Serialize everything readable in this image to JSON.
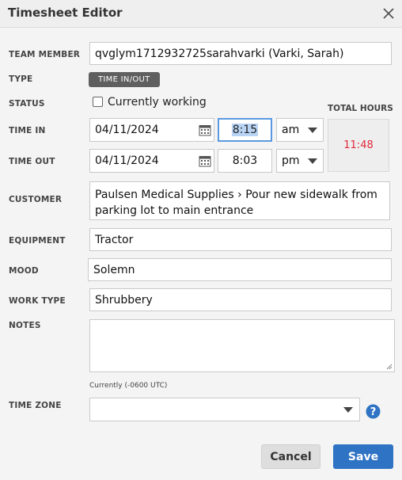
{
  "dialog": {
    "title": "Timesheet Editor",
    "close_icon": "close-icon"
  },
  "labels": {
    "team_member": "TEAM MEMBER",
    "type": "TYPE",
    "status": "STATUS",
    "time_in": "TIME IN",
    "time_out": "TIME OUT",
    "customer": "CUSTOMER",
    "equipment": "EQUIPMENT",
    "mood": "MOOD",
    "work_type": "WORK TYPE",
    "notes": "NOTES",
    "time_zone": "TIME ZONE",
    "total_hours": "TOTAL HOURS"
  },
  "values": {
    "team_member": "qvglym1712932725sarahvarki (Varki, Sarah)",
    "type_badge": "TIME IN/OUT",
    "status_checkbox_label": "Currently working",
    "status_checked": false,
    "time_in_date": "04/11/2024",
    "time_in_time": "8:15",
    "time_in_ampm": "am",
    "time_out_date": "04/11/2024",
    "time_out_time": "8:03",
    "time_out_ampm": "pm",
    "total_hours": "11:48",
    "customer": "Paulsen Medical Supplies › Pour new sidewalk from parking lot to main entrance",
    "equipment": "Tractor",
    "mood": "Solemn",
    "work_type": "Shrubbery",
    "notes": "",
    "timezone_current": "Currently (-0600 UTC)",
    "timezone_value": ""
  },
  "buttons": {
    "cancel": "Cancel",
    "save": "Save"
  },
  "colors": {
    "accent": "#2f73c4",
    "total_hours": "#e0283a",
    "badge": "#5f5f5f",
    "focus": "#5b9ae0"
  }
}
